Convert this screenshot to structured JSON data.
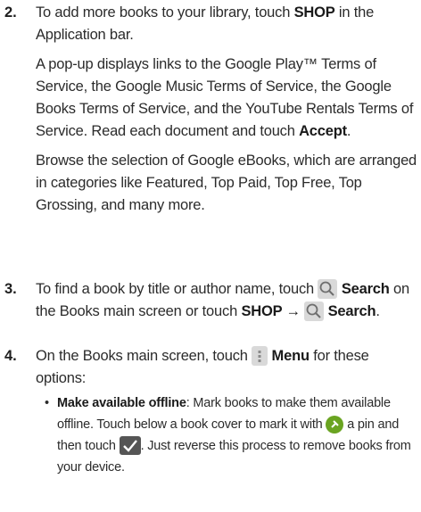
{
  "steps": [
    {
      "number": "2.",
      "intro_a": "To add more books to your library, touch ",
      "intro_b": "SHOP",
      "intro_c": " in the Application bar.",
      "para2_a": "A pop-up displays links to the Google Play™ Terms of Service, the Google Music Terms of Service, the Google Books Terms of Service, and the YouTube Rentals Terms of Service. Read each document and touch ",
      "para2_b": "Accept",
      "para2_c": ".",
      "para3": "Browse the selection of Google eBooks, which are arranged in categories like Featured, Top Paid, Top Free, Top Grossing, and many more."
    },
    {
      "number": "3.",
      "text_a": "To find a book by title or author name, touch ",
      "icon1": "search-icon",
      "text_b": "Search",
      "text_c": " on the Books main screen or touch ",
      "text_d": "SHOP →",
      "icon2": "search-icon",
      "text_e": "Search",
      "text_f": "."
    },
    {
      "number": "4.",
      "text_a": "On the Books main screen, touch ",
      "icon": "menu-icon",
      "text_b": "Menu",
      "text_c": " for these options:",
      "bullet": "•",
      "sub_a": "Make available offline",
      "sub_b": ": Mark books to make them available offline. Touch below a book cover to mark it with ",
      "sub_icon1": "pin-icon",
      "sub_c": " a pin and then touch ",
      "sub_icon2": "checkmark-icon",
      "sub_d": ". Just reverse this process to remove books from your device."
    }
  ]
}
